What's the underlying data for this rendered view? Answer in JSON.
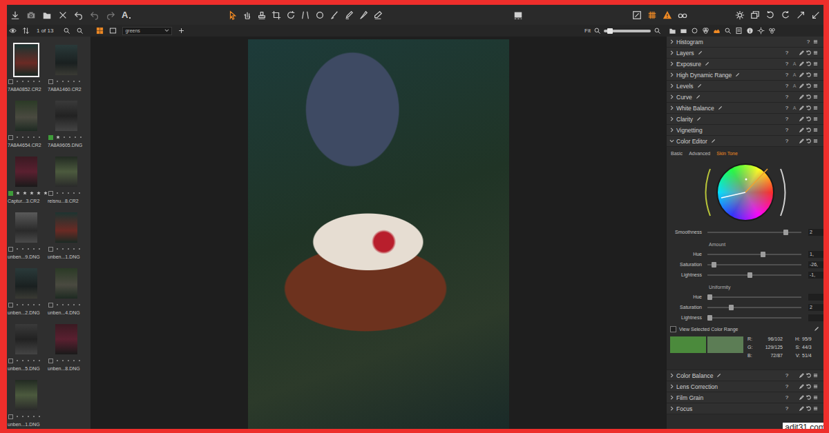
{
  "toolbar": {
    "text_tool": "A",
    "cursor_tools": [
      {
        "selected": true
      },
      {
        "selected": false
      },
      {
        "selected": false
      },
      {
        "selected": false
      },
      {
        "selected": false
      },
      {
        "selected": false
      },
      {
        "selected": false
      },
      {
        "selected": false
      },
      {
        "selected": false
      },
      {
        "selected": false
      },
      {
        "selected": false
      }
    ],
    "overlays": [
      {
        "on": false
      },
      {
        "on": true
      },
      {
        "on": true
      },
      {
        "on": false
      }
    ]
  },
  "browser": {
    "count": "1 of 13",
    "collection": "greens",
    "view_modes": [
      {
        "selected": true
      },
      {
        "selected": false
      }
    ],
    "thumbnails": [
      {
        "name": "7A8A0852.CR2",
        "selected": true,
        "stars": 0,
        "color": null
      },
      {
        "name": "7A8A1460.CR2",
        "selected": false,
        "stars": 0,
        "color": null
      },
      {
        "name": "7A8A4654.CR2",
        "selected": false,
        "stars": 0,
        "color": null
      },
      {
        "name": "7A8A9605.DNG",
        "selected": false,
        "stars": 1,
        "color": "#3f9c3a"
      },
      {
        "name": "Captur...3.CR2",
        "selected": false,
        "stars": 5,
        "color": "#3f9c3a"
      },
      {
        "name": "reisnu...8.CR2",
        "selected": false,
        "stars": 0,
        "color": null
      },
      {
        "name": "unben...9.DNG",
        "selected": false,
        "stars": 0,
        "color": null
      },
      {
        "name": "unben...1.DNG",
        "selected": false,
        "stars": 0,
        "color": null
      },
      {
        "name": "unben...2.DNG",
        "selected": false,
        "stars": 0,
        "color": null
      },
      {
        "name": "unben...4.DNG",
        "selected": false,
        "stars": 0,
        "color": null
      },
      {
        "name": "unben...5.DNG",
        "selected": false,
        "stars": 0,
        "color": null
      },
      {
        "name": "unben...8.DNG",
        "selected": false,
        "stars": 0,
        "color": null
      },
      {
        "name": "unben...1.DNG",
        "selected": false,
        "stars": 0,
        "color": null
      }
    ]
  },
  "viewer": {
    "zoom_label": "Fit",
    "zoom_level": 0.08
  },
  "tool_tabs": [
    {
      "selected": false
    },
    {
      "selected": false
    },
    {
      "selected": false
    },
    {
      "selected": false
    },
    {
      "selected": true
    },
    {
      "selected": false
    },
    {
      "selected": false
    },
    {
      "selected": false
    },
    {
      "selected": false
    },
    {
      "selected": false
    }
  ],
  "help_label": "?",
  "auto_label": "A",
  "tools": [
    {
      "name": "Histogram",
      "expanded": false,
      "local": false,
      "auto": false,
      "actions": false
    },
    {
      "name": "Layers",
      "expanded": false,
      "local": true,
      "auto": false,
      "actions": true
    },
    {
      "name": "Exposure",
      "expanded": false,
      "local": true,
      "auto": true,
      "actions": true
    },
    {
      "name": "High Dynamic Range",
      "expanded": false,
      "local": true,
      "auto": true,
      "actions": true
    },
    {
      "name": "Levels",
      "expanded": false,
      "local": true,
      "auto": true,
      "actions": true
    },
    {
      "name": "Curve",
      "expanded": false,
      "local": true,
      "auto": false,
      "actions": true
    },
    {
      "name": "White Balance",
      "expanded": false,
      "local": true,
      "auto": true,
      "actions": true
    },
    {
      "name": "Clarity",
      "expanded": false,
      "local": true,
      "auto": false,
      "actions": true
    },
    {
      "name": "Vignetting",
      "expanded": false,
      "local": false,
      "auto": false,
      "actions": true
    },
    {
      "name": "Color Editor",
      "expanded": true,
      "local": true,
      "auto": false,
      "actions": true
    },
    {
      "name": "Color Balance",
      "expanded": false,
      "local": true,
      "auto": false,
      "actions": true
    },
    {
      "name": "Lens Correction",
      "expanded": false,
      "local": false,
      "auto": false,
      "actions": true
    },
    {
      "name": "Film Grain",
      "expanded": false,
      "local": false,
      "auto": false,
      "actions": true
    },
    {
      "name": "Focus",
      "expanded": false,
      "local": false,
      "auto": false,
      "actions": true
    }
  ],
  "color_editor": {
    "tabs": [
      {
        "label": "Basic",
        "selected": false
      },
      {
        "label": "Advanced",
        "selected": false
      },
      {
        "label": "Skin Tone",
        "selected": true
      }
    ],
    "controls": [
      {
        "kind": "slider",
        "label": "Smoothness",
        "level": 0.85,
        "reading": "2"
      },
      {
        "kind": "heading",
        "label": "Amount"
      },
      {
        "kind": "slider",
        "label": "Hue",
        "level": 0.6,
        "reading": "1,"
      },
      {
        "kind": "slider",
        "label": "Saturation",
        "level": 0.05,
        "reading": "-26,"
      },
      {
        "kind": "slider",
        "label": "Lightness",
        "level": 0.45,
        "reading": "-1,"
      },
      {
        "kind": "heading",
        "label": "Uniformity"
      },
      {
        "kind": "slider",
        "label": "Hue",
        "level": 0.0,
        "reading": ""
      },
      {
        "kind": "slider",
        "label": "Saturation",
        "level": 0.24,
        "reading": "2"
      },
      {
        "kind": "slider",
        "label": "Lightness",
        "level": 0.0,
        "reading": ""
      }
    ],
    "view_range": {
      "label": "View Selected Color Range",
      "checked": false
    },
    "swatches": [
      {
        "color": "#4b8a3c"
      },
      {
        "color": "#5c7d55"
      }
    ],
    "readouts": [
      {
        "channel": "R:",
        "rgb": "96/102",
        "hsv_channel": "H:",
        "hsv": "95/9"
      },
      {
        "channel": "G:",
        "rgb": "129/125",
        "hsv_channel": "S:",
        "hsv": "44/3"
      },
      {
        "channel": "B:",
        "rgb": "72/87",
        "hsv_channel": "V:",
        "hsv": "51/4"
      }
    ]
  },
  "watermark": "adit31.com"
}
